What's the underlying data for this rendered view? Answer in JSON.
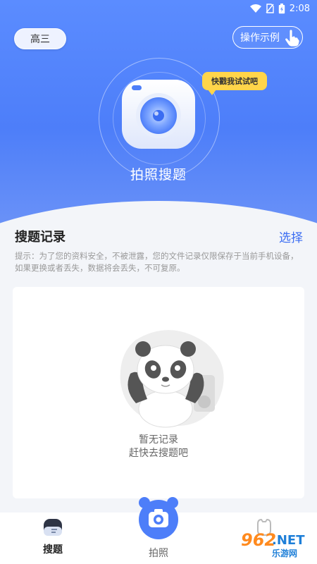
{
  "status_bar": {
    "time": "2:08"
  },
  "header": {
    "grade_label": "高三",
    "demo_label": "操作示例",
    "bubble_text": "快戳我试试吧",
    "title": "拍照搜题"
  },
  "records": {
    "title": "搜题记录",
    "select_label": "选择",
    "tip": "提示：为了您的资料安全，不被泄露，您的文件记录仅限保存于当前手机设备，如果更换或者丢失，数据将会丢失，不可复原。",
    "empty_line1": "暂无记录",
    "empty_line2": "赶快去搜题吧"
  },
  "bottom_nav": {
    "search_label": "搜题",
    "photo_label": "拍照"
  },
  "watermark": {
    "number": "962",
    "suffix": ".NET",
    "sub": "乐游网"
  },
  "colors": {
    "primary": "#4d7ef9",
    "accent": "#3b6df2",
    "bubble": "#ffd54a",
    "background": "#f3f5f9"
  }
}
